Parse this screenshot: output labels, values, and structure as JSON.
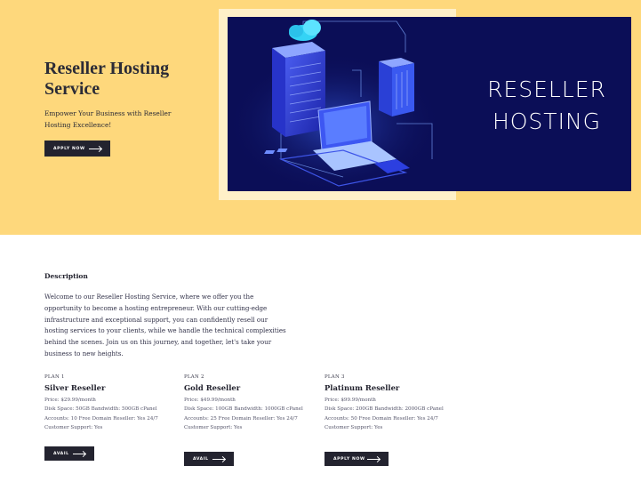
{
  "hero": {
    "title": "Reseller Hosting Service",
    "subtitle": "Empower Your Business with Reseller Hosting Excellence!",
    "cta_label": "APPLY NOW",
    "background_color": "#fed87c"
  },
  "banner": {
    "line1": "RESELLER",
    "line2": "HOSTING",
    "background_color": "#0b0e57",
    "illustration_icons": [
      "server-rack-icon",
      "cloud-icon",
      "laptop-icon",
      "circuit-board-icon"
    ]
  },
  "description": {
    "heading": "Description",
    "text": "Welcome to our Reseller Hosting Service, where we offer you the opportunity to become a hosting entrepreneur. With our cutting-edge infrastructure and exceptional support, you can confidently resell our hosting services to your clients, while we handle the technical complexities behind the scenes. Join us on this journey, and together, let's take your business to new heights."
  },
  "plans": [
    {
      "number": "PLAN 1",
      "name": "Silver Reseller",
      "price": "Price: $29.99/month",
      "specs": "Disk Space: 50GB Bandwidth: 500GB cPanel",
      "accounts": "Accounts: 10 Free Domain Reseller: Yes 24/7",
      "support": "Customer Support: Yes",
      "button": "AVAIL"
    },
    {
      "number": "PLAN 2",
      "name": "Gold Reseller",
      "price": "Price: $49.99/month",
      "specs": "Disk Space: 100GB Bandwidth: 1000GB cPanel",
      "accounts": "Accounts: 25 Free Domain Reseller: Yes 24/7",
      "support": "Customer Support: Yes",
      "button": "AVAIL"
    },
    {
      "number": "PLAN 3",
      "name": "Platinum Reseller",
      "price": "Price: $99.99/month",
      "specs": "Disk Space: 200GB Bandwidth: 2000GB cPanel",
      "accounts": "Accounts: 50 Free Domain Reseller: Yes 24/7",
      "support": "Customer Support: Yes",
      "button": "APPLY NOW"
    }
  ],
  "colors": {
    "button": "#23232f",
    "accent_yellow": "#fed87c",
    "banner_navy": "#0b0e57"
  }
}
